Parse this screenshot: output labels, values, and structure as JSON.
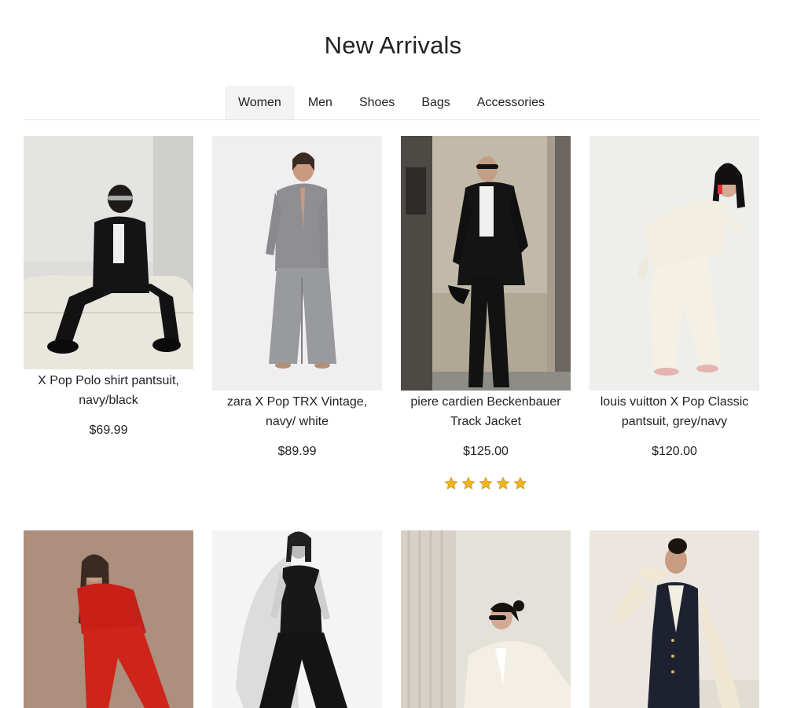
{
  "page": {
    "title": "New Arrivals"
  },
  "tabs": [
    {
      "label": "Women",
      "active": true
    },
    {
      "label": "Men",
      "active": false
    },
    {
      "label": "Shoes",
      "active": false
    },
    {
      "label": "Bags",
      "active": false
    },
    {
      "label": "Accessories",
      "active": false
    }
  ],
  "products": [
    {
      "name": "X Pop Polo shirt pantsuit, navy/black",
      "price": "$69.99",
      "rating": 0
    },
    {
      "name": "zara X Pop TRX Vintage, navy/ white",
      "price": "$89.99",
      "rating": 0
    },
    {
      "name": "piere cardien Beckenbauer Track Jacket",
      "price": "$125.00",
      "rating": 5
    },
    {
      "name": "louis vuitton X Pop Classic pantsuit, grey/navy",
      "price": "$120.00",
      "rating": 0
    }
  ],
  "colors": {
    "star": "#f2b51c",
    "tab_active_bg": "#f3f3f3",
    "divider": "#e2e2e2"
  }
}
